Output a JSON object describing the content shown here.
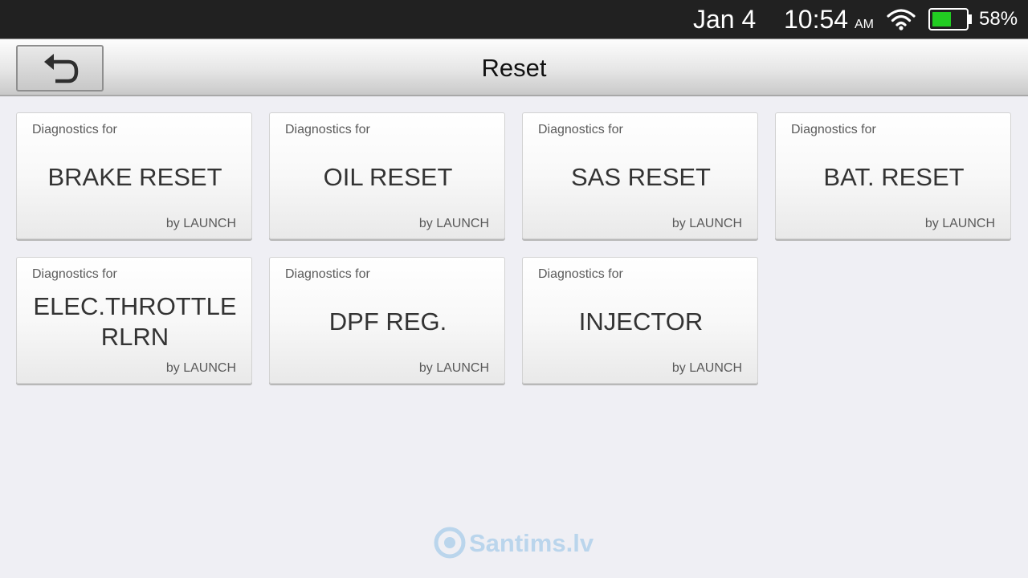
{
  "status_bar": {
    "date": "Jan 4",
    "time": "10:54",
    "ampm": "AM",
    "wifi_icon": "wifi-icon",
    "battery_icon": "battery-icon",
    "battery_level": 0.58,
    "battery_percent": "58%",
    "battery_color": "#22cc22"
  },
  "title_bar": {
    "back_icon": "back-arrow-icon",
    "title": "Reset"
  },
  "tiles": [
    {
      "prefix": "Diagnostics for",
      "name": "BRAKE RESET",
      "brand": "by LAUNCH"
    },
    {
      "prefix": "Diagnostics for",
      "name": "OIL RESET",
      "brand": "by LAUNCH"
    },
    {
      "prefix": "Diagnostics for",
      "name": "SAS RESET",
      "brand": "by LAUNCH"
    },
    {
      "prefix": "Diagnostics for",
      "name": "BAT. RESET",
      "brand": "by LAUNCH"
    },
    {
      "prefix": "Diagnostics for",
      "name": "ELEC.THROTTLE RLRN",
      "brand": "by LAUNCH"
    },
    {
      "prefix": "Diagnostics for",
      "name": "DPF REG.",
      "brand": "by LAUNCH"
    },
    {
      "prefix": "Diagnostics for",
      "name": "INJECTOR",
      "brand": "by LAUNCH"
    }
  ],
  "watermark": {
    "text": "Santims.lv",
    "logo_text": "SANTIMS"
  }
}
